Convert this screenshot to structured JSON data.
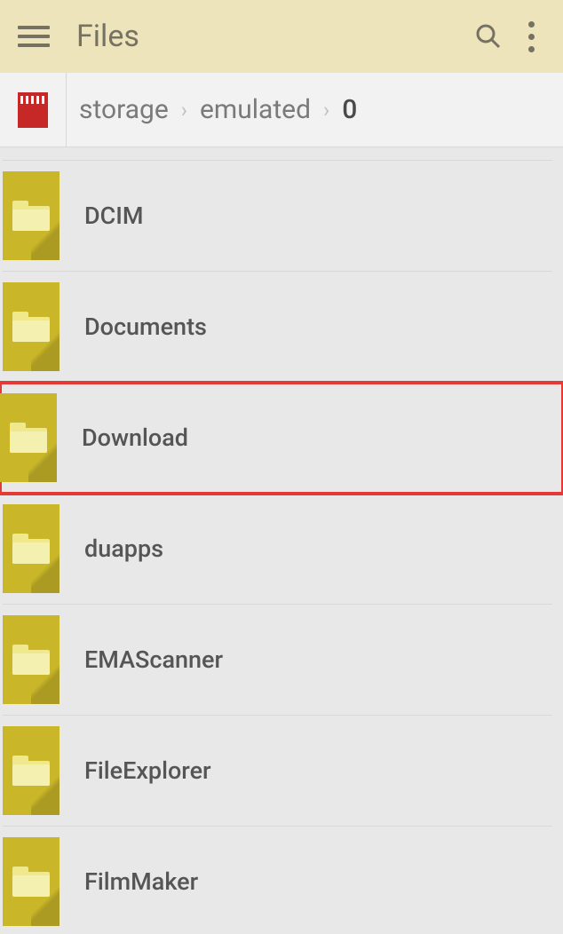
{
  "header": {
    "title": "Files"
  },
  "breadcrumb": {
    "items": [
      {
        "label": "storage",
        "active": false
      },
      {
        "label": "emulated",
        "active": false
      },
      {
        "label": "0",
        "active": true
      }
    ]
  },
  "list": {
    "items": [
      {
        "name": "DCIM",
        "highlighted": false
      },
      {
        "name": "Documents",
        "highlighted": false
      },
      {
        "name": "Download",
        "highlighted": true
      },
      {
        "name": "duapps",
        "highlighted": false
      },
      {
        "name": "EMAScanner",
        "highlighted": false
      },
      {
        "name": "FileExplorer",
        "highlighted": false
      },
      {
        "name": "FilmMaker",
        "highlighted": false
      }
    ]
  }
}
